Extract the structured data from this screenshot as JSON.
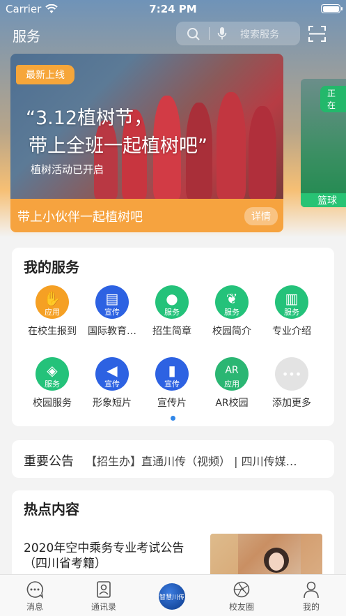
{
  "status": {
    "carrier": "Carrier",
    "time": "7:24 PM"
  },
  "header": {
    "title": "服务",
    "search_placeholder": "搜索服务"
  },
  "banner": {
    "tag": "最新上线",
    "headline_1": "“3.12植树节，",
    "headline_2": "带上全班一起植树吧”",
    "subtitle": "植树活动已开启",
    "footer": "带上小伙伴一起植树吧",
    "detail_button": "详情"
  },
  "banner2": {
    "tag": "正在",
    "footer": "篮球赛"
  },
  "services": {
    "title": "我的服务",
    "items": [
      {
        "label": "在校生报到",
        "badge": "应用",
        "icon": "hand-icon",
        "color": "#f5a024"
      },
      {
        "label": "国际教育…",
        "badge": "宣传",
        "icon": "document-icon",
        "color": "#2d62e2"
      },
      {
        "label": "招生简章",
        "badge": "服务",
        "icon": "person-icon",
        "color": "#24c27a"
      },
      {
        "label": "校园简介",
        "badge": "服务",
        "icon": "leaf-icon",
        "color": "#24c27a"
      },
      {
        "label": "专业介绍",
        "badge": "服务",
        "icon": "book-icon",
        "color": "#24c27a"
      },
      {
        "label": "校园服务",
        "badge": "服务",
        "icon": "compass-icon",
        "color": "#24c27a"
      },
      {
        "label": "形象短片",
        "badge": "宣传",
        "icon": "speaker-icon",
        "color": "#2d62e2"
      },
      {
        "label": "宣传片",
        "badge": "宣传",
        "icon": "bookmark-icon",
        "color": "#2d62e2"
      },
      {
        "label": "AR校园",
        "badge": "应用",
        "icon": "ar-icon",
        "color": "#2bb673"
      },
      {
        "label": "添加更多",
        "badge": "",
        "icon": "more-icon",
        "color": "#e3e3e3"
      }
    ]
  },
  "notice": {
    "title": "重要公告",
    "text": "【招生办】直通川传（视频） | 四川传媒…"
  },
  "hot": {
    "title": "热点内容",
    "item_title": "2020年空中乘务专业考试公告（四川省考籍）"
  },
  "tabs": [
    {
      "label": "消息",
      "icon": "message-icon"
    },
    {
      "label": "通讯录",
      "icon": "contacts-icon"
    },
    {
      "label": "",
      "icon": "logo-icon",
      "logo_text": "智慧川传"
    },
    {
      "label": "校友圈",
      "icon": "aperture-icon"
    },
    {
      "label": "我的",
      "icon": "profile-icon"
    }
  ]
}
